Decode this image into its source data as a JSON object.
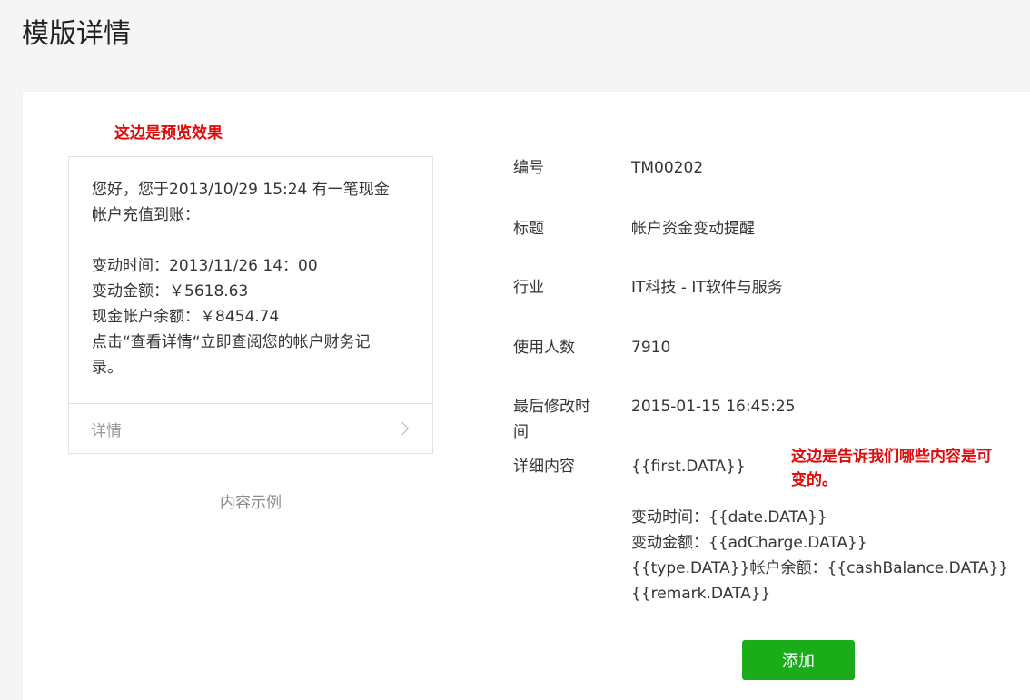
{
  "page": {
    "title": "模版详情"
  },
  "annotations": {
    "preview": "这边是预览效果",
    "variable": "这边是告诉我们哪些内容是可变的。"
  },
  "preview": {
    "lines_top": [
      "您好，您于2013/10/29 15:24 有一笔现金",
      "帐户充值到账："
    ],
    "lines_bottom": [
      "变动时间：2013/11/26 14：00",
      "变动金额：￥5618.63",
      "现金帐户余额：￥8454.74",
      "点击“查看详情“立即查阅您的帐户财务记",
      "录。"
    ],
    "footer_label": "详情",
    "caption": "内容示例"
  },
  "info": {
    "id_label": "编号",
    "id_value": "TM00202",
    "title_label": "标题",
    "title_value": "帐户资金变动提醒",
    "industry_label": "行业",
    "industry_value": "IT科技 - IT软件与服务",
    "users_label": "使用人数",
    "users_value": "7910",
    "modified_label_1": "最后修改时",
    "modified_label_2": "间",
    "modified_value": "2015-01-15 16:45:25",
    "content_label": "详细内容",
    "content_first": "{{first.DATA}}",
    "content_lines": [
      "变动时间：{{date.DATA}}",
      "变动金额：{{adCharge.DATA}}",
      "{{type.DATA}}帐户余额：{{cashBalance.DATA}}",
      "{{remark.DATA}}"
    ]
  },
  "actions": {
    "add_label": "添加"
  },
  "colors": {
    "accent_green": "#1aad19",
    "annotation_red": "#e10909"
  }
}
